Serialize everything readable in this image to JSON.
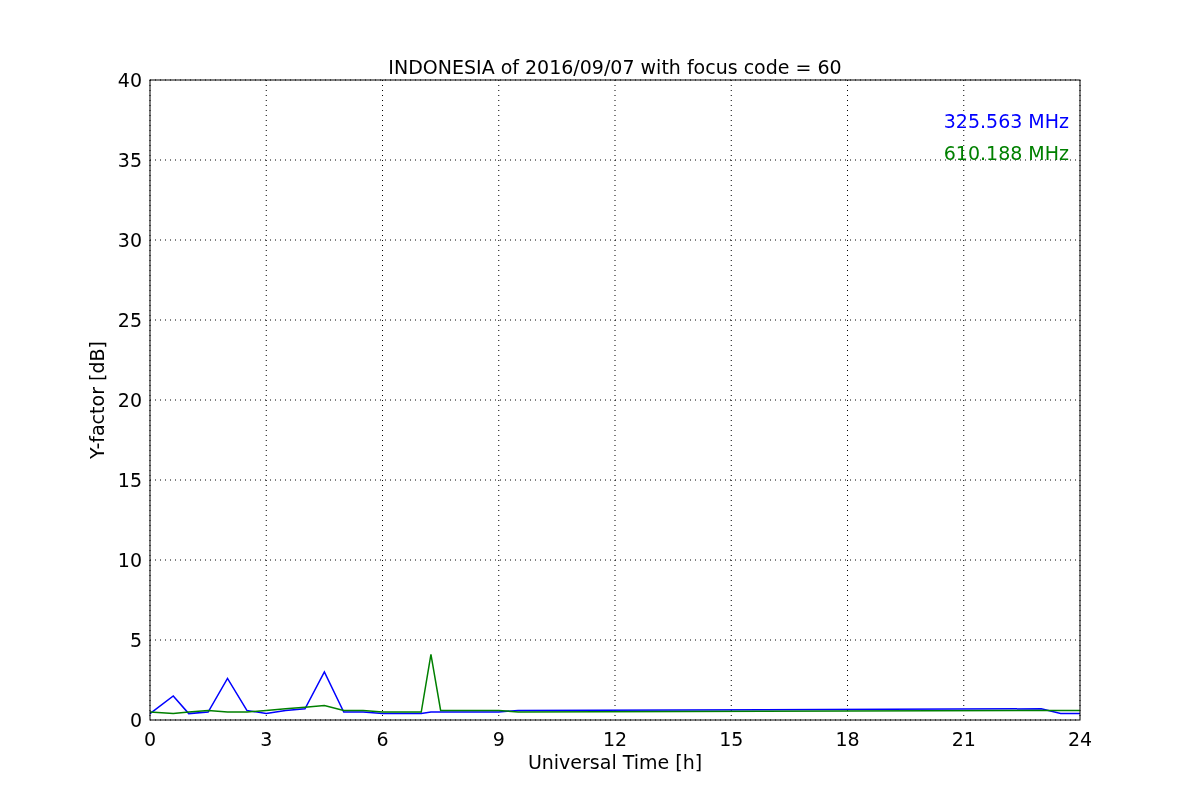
{
  "chart_data": {
    "type": "line",
    "title": "INDONESIA of 2016/09/07 with focus code = 60",
    "xlabel": "Universal Time [h]",
    "ylabel": "Y-factor [dB]",
    "x": [
      0,
      0.6,
      1,
      1.5,
      2,
      2.5,
      3,
      3.5,
      4,
      4.5,
      5,
      5.5,
      6,
      6.5,
      7,
      7.25,
      7.5,
      8,
      8.5,
      9,
      9.5,
      23,
      23.5,
      24
    ],
    "series": [
      {
        "name": "325.563 MHz",
        "color": "#0000ff",
        "values": [
          0.4,
          1.5,
          0.4,
          0.5,
          2.6,
          0.6,
          0.4,
          0.6,
          0.7,
          3.0,
          0.5,
          0.5,
          0.4,
          0.4,
          0.4,
          0.5,
          0.5,
          0.5,
          0.5,
          0.5,
          0.6,
          0.7,
          0.4,
          0.4
        ]
      },
      {
        "name": "610.188 MHz",
        "color": "#008000",
        "values": [
          0.5,
          0.4,
          0.5,
          0.6,
          0.5,
          0.5,
          0.6,
          0.7,
          0.8,
          0.9,
          0.6,
          0.6,
          0.5,
          0.5,
          0.5,
          4.1,
          0.6,
          0.6,
          0.6,
          0.6,
          0.5,
          0.6,
          0.6,
          0.6
        ]
      }
    ],
    "grid": true,
    "xlim": [
      0,
      24
    ],
    "ylim": [
      0,
      40
    ],
    "xticks": [
      0,
      3,
      6,
      9,
      12,
      15,
      18,
      21,
      24
    ],
    "yticks": [
      0,
      5,
      10,
      15,
      20,
      25,
      30,
      35,
      40
    ]
  }
}
